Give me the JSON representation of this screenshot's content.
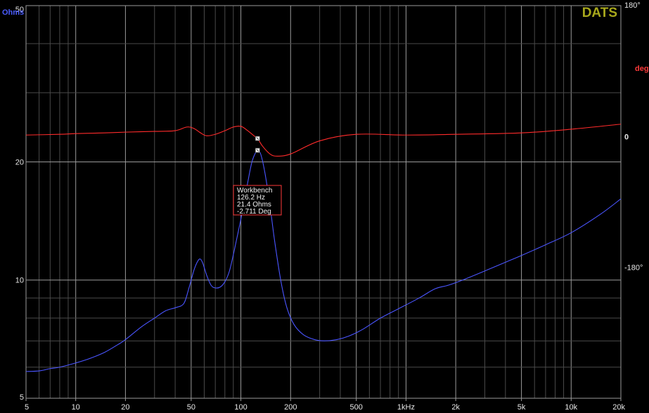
{
  "brand": "DATS",
  "colors": {
    "background": "#000000",
    "grid_major": "#9a9a9a",
    "grid_minor": "#4a4a4a",
    "impedance": "#4a55ff",
    "phase": "#ff2b2b",
    "tooltip_border": "#ff3a3a"
  },
  "chart_data": {
    "type": "line",
    "x_scale": "log",
    "xlim": [
      5,
      20000
    ],
    "x_ticks": [
      5,
      10,
      20,
      50,
      100,
      200,
      500,
      1000,
      2000,
      5000,
      10000,
      20000
    ],
    "x_tick_labels": [
      "5",
      "10",
      "20",
      "50",
      "100",
      "200",
      "500",
      "1kHz",
      "2k",
      "5k",
      "10k",
      "20k"
    ],
    "y_left": {
      "label": "Ohms",
      "scale": "log",
      "lim": [
        5,
        50
      ],
      "ticks": [
        5,
        10,
        20,
        50
      ],
      "tick_labels": [
        "5",
        "10",
        "20",
        "50"
      ]
    },
    "y_right": {
      "label": "deg",
      "lim": [
        -360,
        180
      ],
      "ticks": [
        180,
        0,
        -180
      ],
      "tick_labels": [
        "180°",
        "0",
        "-180°"
      ]
    },
    "grid": true,
    "series": [
      {
        "name": "Workbench",
        "color": "#4a55ff",
        "axis": "left",
        "unit": "Ohms",
        "points": [
          [
            5,
            5.85
          ],
          [
            6,
            5.87
          ],
          [
            7,
            5.95
          ],
          [
            8,
            6.0
          ],
          [
            10,
            6.15
          ],
          [
            12,
            6.3
          ],
          [
            15,
            6.55
          ],
          [
            18,
            6.85
          ],
          [
            20,
            7.05
          ],
          [
            25,
            7.6
          ],
          [
            30,
            8.0
          ],
          [
            35,
            8.35
          ],
          [
            40,
            8.5
          ],
          [
            45,
            8.7
          ],
          [
            48,
            9.4
          ],
          [
            52,
            10.6
          ],
          [
            55,
            11.2
          ],
          [
            57,
            11.3
          ],
          [
            59,
            11.0
          ],
          [
            62,
            10.3
          ],
          [
            66,
            9.7
          ],
          [
            70,
            9.55
          ],
          [
            75,
            9.6
          ],
          [
            80,
            9.9
          ],
          [
            85,
            10.5
          ],
          [
            90,
            11.6
          ],
          [
            95,
            12.9
          ],
          [
            100,
            14.3
          ],
          [
            108,
            17.0
          ],
          [
            116,
            19.8
          ],
          [
            122,
            21.0
          ],
          [
            126.2,
            21.4
          ],
          [
            132,
            20.9
          ],
          [
            140,
            18.7
          ],
          [
            150,
            15.5
          ],
          [
            160,
            12.6
          ],
          [
            175,
            9.9
          ],
          [
            190,
            8.5
          ],
          [
            210,
            7.7
          ],
          [
            240,
            7.25
          ],
          [
            280,
            7.05
          ],
          [
            320,
            7.0
          ],
          [
            380,
            7.05
          ],
          [
            450,
            7.2
          ],
          [
            550,
            7.5
          ],
          [
            700,
            8.0
          ],
          [
            900,
            8.45
          ],
          [
            1200,
            9.0
          ],
          [
            1500,
            9.5
          ],
          [
            1800,
            9.7
          ],
          [
            2200,
            10.0
          ],
          [
            3000,
            10.55
          ],
          [
            4000,
            11.1
          ],
          [
            5000,
            11.55
          ],
          [
            7000,
            12.3
          ],
          [
            10000,
            13.2
          ],
          [
            15000,
            14.7
          ],
          [
            20000,
            16.1
          ]
        ]
      },
      {
        "name": "Workbench phase",
        "color": "#ff2b2b",
        "axis": "right",
        "unit": "deg",
        "points": [
          [
            5,
            2
          ],
          [
            8,
            3
          ],
          [
            10,
            4
          ],
          [
            15,
            5
          ],
          [
            20,
            6
          ],
          [
            30,
            7
          ],
          [
            40,
            8
          ],
          [
            47,
            13
          ],
          [
            52,
            11
          ],
          [
            57,
            5
          ],
          [
            62,
            1
          ],
          [
            70,
            3
          ],
          [
            80,
            8
          ],
          [
            90,
            13
          ],
          [
            100,
            14
          ],
          [
            110,
            8
          ],
          [
            120,
            1
          ],
          [
            126.2,
            -2.711
          ],
          [
            135,
            -13
          ],
          [
            150,
            -24
          ],
          [
            165,
            -27
          ],
          [
            200,
            -24
          ],
          [
            300,
            -6
          ],
          [
            500,
            3
          ],
          [
            1000,
            2
          ],
          [
            2000,
            3
          ],
          [
            5000,
            5
          ],
          [
            10000,
            10
          ],
          [
            20000,
            17
          ]
        ]
      }
    ],
    "marker": {
      "series": "Workbench",
      "freq_label": "126.2 Hz",
      "ohms_label": "21.4 Ohms",
      "deg_label": "-2.711 Deg",
      "hz": 126.2,
      "ohms": 21.4,
      "deg": -2.711
    }
  }
}
